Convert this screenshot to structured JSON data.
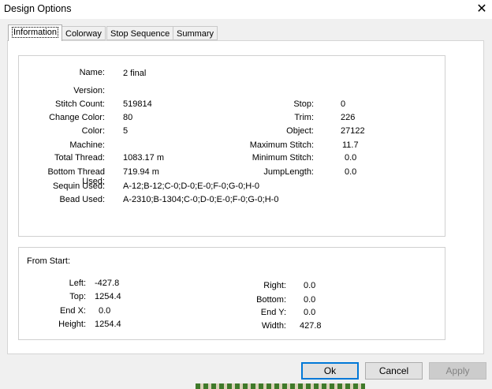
{
  "window": {
    "title": "Design Options",
    "close_icon": "close-icon"
  },
  "tabs": [
    {
      "label": "Information",
      "active": true
    },
    {
      "label": "Colorway",
      "active": false
    },
    {
      "label": "Stop Sequence",
      "active": false
    },
    {
      "label": "Summary",
      "active": false
    }
  ],
  "info": {
    "name": {
      "label": "Name:",
      "value": "2 final"
    },
    "version": {
      "label": "Version:",
      "value": ""
    },
    "stitch_count": {
      "label": "Stitch Count:",
      "value": "519814"
    },
    "change_color": {
      "label": "Change Color:",
      "value": "80"
    },
    "color": {
      "label": "Color:",
      "value": "5"
    },
    "machine": {
      "label": "Machine:",
      "value": ""
    },
    "total_thread": {
      "label": "Total Thread:",
      "value": "1083.17 m"
    },
    "bottom_thread": {
      "label": "Bottom Thread Used:",
      "value": "719.94 m"
    },
    "sequin": {
      "label": "Sequin Used:",
      "value": "A-12;B-12;C-0;D-0;E-0;F-0;G-0;H-0"
    },
    "bead": {
      "label": "Bead Used:",
      "value": "A-2310;B-1304;C-0;D-0;E-0;F-0;G-0;H-0"
    },
    "stop": {
      "label": "Stop:",
      "value": "0"
    },
    "trim": {
      "label": "Trim:",
      "value": "226"
    },
    "object": {
      "label": "Object:",
      "value": "27122"
    },
    "max_stitch": {
      "label": "Maximum Stitch:",
      "value": "11.7"
    },
    "min_stitch": {
      "label": "Minimum Stitch:",
      "value": "0.0"
    },
    "jump_length": {
      "label": "JumpLength:",
      "value": "0.0"
    }
  },
  "from_start": {
    "heading": "From Start:",
    "left": {
      "label": "Left:",
      "value": "-427.8"
    },
    "top": {
      "label": "Top:",
      "value": "1254.4"
    },
    "end_x": {
      "label": "End X:",
      "value": "0.0"
    },
    "height": {
      "label": "Height:",
      "value": "1254.4"
    },
    "right": {
      "label": "Right:",
      "value": "0.0"
    },
    "bottom": {
      "label": "Bottom:",
      "value": "0.0"
    },
    "end_y": {
      "label": "End Y:",
      "value": "0.0"
    },
    "width": {
      "label": "Width:",
      "value": "427.8"
    }
  },
  "buttons": {
    "ok": "Ok",
    "cancel": "Cancel",
    "apply": "Apply"
  }
}
